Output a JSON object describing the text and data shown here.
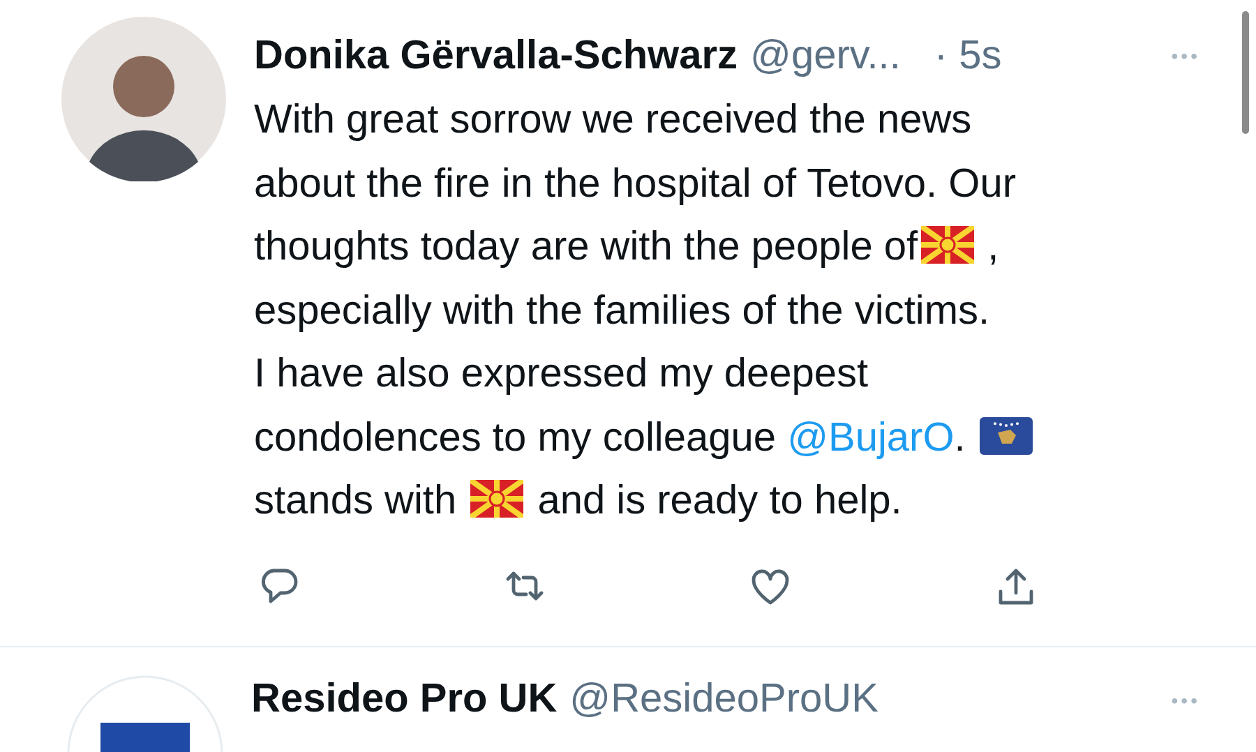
{
  "tweets": [
    {
      "author": "Donika Gërvalla-Schwarz",
      "handle": "@gerv...",
      "time": "· 5s",
      "more": "•••",
      "avatar": {
        "kind": "person"
      },
      "lines": [
        [
          {
            "kind": "text",
            "text": "With great sorrow we received the news"
          }
        ],
        [
          {
            "kind": "text",
            "text": "about the fire in the hospital of Tetovo. Our"
          }
        ],
        [
          {
            "kind": "text",
            "text": "thoughts today are with the people of"
          },
          {
            "kind": "mk_flag"
          },
          {
            "kind": "text",
            "text": " ,"
          }
        ],
        [
          {
            "kind": "text",
            "text": "especially with the families of the victims."
          }
        ],
        [
          {
            "kind": "text",
            "text": "I have also expressed my deepest"
          }
        ],
        [
          {
            "kind": "text",
            "text": "condolences to my colleague "
          },
          {
            "kind": "mention",
            "text": "@BujarO"
          },
          {
            "kind": "text",
            "text": ". "
          },
          {
            "kind": "xk_flag"
          }
        ],
        [
          {
            "kind": "text",
            "text": "stands with "
          },
          {
            "kind": "mk_flag"
          },
          {
            "kind": "text",
            "text": " and is ready to help."
          }
        ]
      ],
      "actions": [
        {
          "kind": "reply"
        },
        {
          "kind": "retweet"
        },
        {
          "kind": "like"
        },
        {
          "kind": "share"
        }
      ]
    },
    {
      "author": "Resideo Pro UK",
      "handle": "@ResideoProUK",
      "more": "•••",
      "avatar": {
        "kind": "logo"
      }
    }
  ]
}
